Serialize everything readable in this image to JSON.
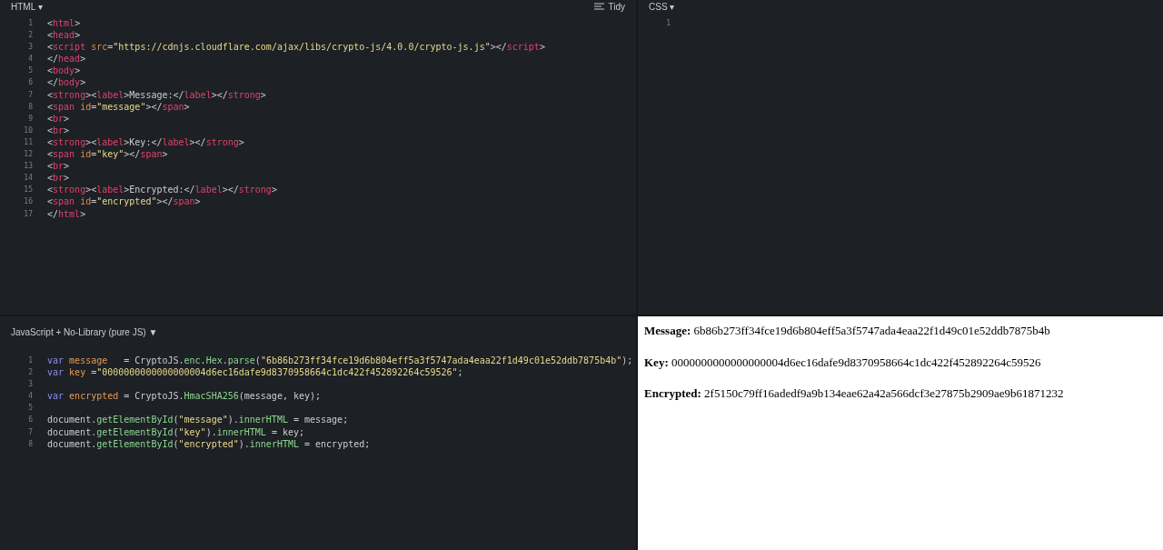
{
  "html_panel": {
    "title": "HTML ▾",
    "tidy_label": "Tidy",
    "lines": [
      {
        "number": "1",
        "tokens": [
          {
            "kind": "punct",
            "text": "<"
          },
          {
            "kind": "tag",
            "text": "html"
          },
          {
            "kind": "punct",
            "text": ">"
          }
        ]
      },
      {
        "number": "2",
        "tokens": [
          {
            "kind": "punct",
            "text": "<"
          },
          {
            "kind": "tag",
            "text": "head"
          },
          {
            "kind": "punct",
            "text": ">"
          }
        ]
      },
      {
        "number": "3",
        "tokens": [
          {
            "kind": "punct",
            "text": "<"
          },
          {
            "kind": "tag",
            "text": "script"
          },
          {
            "kind": "attr",
            "text": " src"
          },
          {
            "kind": "punct",
            "text": "="
          },
          {
            "kind": "string",
            "text": "\"https://cdnjs.cloudflare.com/ajax/libs/crypto-js/4.0.0/crypto-js.js\""
          },
          {
            "kind": "punct",
            "text": "></"
          },
          {
            "kind": "tag",
            "text": "script"
          },
          {
            "kind": "punct",
            "text": ">"
          }
        ]
      },
      {
        "number": "4",
        "tokens": [
          {
            "kind": "punct",
            "text": "</"
          },
          {
            "kind": "tag",
            "text": "head"
          },
          {
            "kind": "punct",
            "text": ">"
          }
        ]
      },
      {
        "number": "5",
        "tokens": [
          {
            "kind": "punct",
            "text": "<"
          },
          {
            "kind": "tag",
            "text": "body"
          },
          {
            "kind": "punct",
            "text": ">"
          }
        ]
      },
      {
        "number": "6",
        "tokens": [
          {
            "kind": "punct",
            "text": "</"
          },
          {
            "kind": "tag",
            "text": "body"
          },
          {
            "kind": "punct",
            "text": ">"
          }
        ]
      },
      {
        "number": "7",
        "tokens": [
          {
            "kind": "punct",
            "text": "<"
          },
          {
            "kind": "tag",
            "text": "strong"
          },
          {
            "kind": "punct",
            "text": "><"
          },
          {
            "kind": "tag",
            "text": "label"
          },
          {
            "kind": "punct",
            "text": ">Message:</"
          },
          {
            "kind": "tag",
            "text": "label"
          },
          {
            "kind": "punct",
            "text": "></"
          },
          {
            "kind": "tag",
            "text": "strong"
          },
          {
            "kind": "punct",
            "text": ">"
          }
        ]
      },
      {
        "number": "8",
        "tokens": [
          {
            "kind": "punct",
            "text": "<"
          },
          {
            "kind": "tag",
            "text": "span"
          },
          {
            "kind": "attr",
            "text": " id"
          },
          {
            "kind": "punct",
            "text": "="
          },
          {
            "kind": "string",
            "text": "\"message\""
          },
          {
            "kind": "punct",
            "text": "></"
          },
          {
            "kind": "tag",
            "text": "span"
          },
          {
            "kind": "punct",
            "text": ">"
          }
        ]
      },
      {
        "number": "9",
        "tokens": [
          {
            "kind": "punct",
            "text": "<"
          },
          {
            "kind": "tag",
            "text": "br"
          },
          {
            "kind": "punct",
            "text": ">"
          }
        ]
      },
      {
        "number": "10",
        "tokens": [
          {
            "kind": "punct",
            "text": "<"
          },
          {
            "kind": "tag",
            "text": "br"
          },
          {
            "kind": "punct",
            "text": ">"
          }
        ]
      },
      {
        "number": "11",
        "tokens": [
          {
            "kind": "punct",
            "text": "<"
          },
          {
            "kind": "tag",
            "text": "strong"
          },
          {
            "kind": "punct",
            "text": "><"
          },
          {
            "kind": "tag",
            "text": "label"
          },
          {
            "kind": "punct",
            "text": ">Key:</"
          },
          {
            "kind": "tag",
            "text": "label"
          },
          {
            "kind": "punct",
            "text": "></"
          },
          {
            "kind": "tag",
            "text": "strong"
          },
          {
            "kind": "punct",
            "text": ">"
          }
        ]
      },
      {
        "number": "12",
        "tokens": [
          {
            "kind": "punct",
            "text": "<"
          },
          {
            "kind": "tag",
            "text": "span"
          },
          {
            "kind": "attr",
            "text": " id"
          },
          {
            "kind": "punct",
            "text": "="
          },
          {
            "kind": "string",
            "text": "\"key\""
          },
          {
            "kind": "punct",
            "text": "></"
          },
          {
            "kind": "tag",
            "text": "span"
          },
          {
            "kind": "punct",
            "text": ">"
          }
        ]
      },
      {
        "number": "13",
        "tokens": [
          {
            "kind": "punct",
            "text": "<"
          },
          {
            "kind": "tag",
            "text": "br"
          },
          {
            "kind": "punct",
            "text": ">"
          }
        ]
      },
      {
        "number": "14",
        "tokens": [
          {
            "kind": "punct",
            "text": "<"
          },
          {
            "kind": "tag",
            "text": "br"
          },
          {
            "kind": "punct",
            "text": ">"
          }
        ]
      },
      {
        "number": "15",
        "tokens": [
          {
            "kind": "punct",
            "text": "<"
          },
          {
            "kind": "tag",
            "text": "strong"
          },
          {
            "kind": "punct",
            "text": "><"
          },
          {
            "kind": "tag",
            "text": "label"
          },
          {
            "kind": "punct",
            "text": ">Encrypted:</"
          },
          {
            "kind": "tag",
            "text": "label"
          },
          {
            "kind": "punct",
            "text": "></"
          },
          {
            "kind": "tag",
            "text": "strong"
          },
          {
            "kind": "punct",
            "text": ">"
          }
        ]
      },
      {
        "number": "16",
        "tokens": [
          {
            "kind": "punct",
            "text": "<"
          },
          {
            "kind": "tag",
            "text": "span"
          },
          {
            "kind": "attr",
            "text": " id"
          },
          {
            "kind": "punct",
            "text": "="
          },
          {
            "kind": "string",
            "text": "\"encrypted\""
          },
          {
            "kind": "punct",
            "text": "></"
          },
          {
            "kind": "tag",
            "text": "span"
          },
          {
            "kind": "punct",
            "text": ">"
          }
        ]
      },
      {
        "number": "17",
        "tokens": [
          {
            "kind": "punct",
            "text": "</"
          },
          {
            "kind": "tag",
            "text": "html"
          },
          {
            "kind": "punct",
            "text": ">"
          }
        ]
      }
    ]
  },
  "css_panel": {
    "title": "CSS ▾",
    "lines": [
      {
        "number": "1"
      }
    ]
  },
  "js_panel": {
    "title": "JavaScript + No-Library (pure JS) ▼",
    "lines": [
      {
        "number": "1",
        "tokens": [
          {
            "kind": "keyword",
            "text": "var "
          },
          {
            "kind": "variable",
            "text": "message"
          },
          {
            "kind": "punct",
            "text": "   = CryptoJS."
          },
          {
            "kind": "function",
            "text": "enc"
          },
          {
            "kind": "punct",
            "text": "."
          },
          {
            "kind": "function",
            "text": "Hex"
          },
          {
            "kind": "punct",
            "text": "."
          },
          {
            "kind": "function",
            "text": "parse"
          },
          {
            "kind": "punct",
            "text": "("
          },
          {
            "kind": "string",
            "text": "\"6b86b273ff34fce19d6b804eff5a3f5747ada4eaa22f1d49c01e52ddb7875b4b\""
          },
          {
            "kind": "punct",
            "text": ");"
          }
        ]
      },
      {
        "number": "2",
        "tokens": [
          {
            "kind": "keyword",
            "text": "var "
          },
          {
            "kind": "variable",
            "text": "key"
          },
          {
            "kind": "punct",
            "text": " ="
          },
          {
            "kind": "string",
            "text": "\"0000000000000000004d6ec16dafe9d8370958664c1dc422f452892264c59526\""
          },
          {
            "kind": "punct",
            "text": ";"
          }
        ]
      },
      {
        "number": "3"
      },
      {
        "number": "4",
        "tokens": [
          {
            "kind": "keyword",
            "text": "var "
          },
          {
            "kind": "variable",
            "text": "encrypted"
          },
          {
            "kind": "punct",
            "text": " = CryptoJS."
          },
          {
            "kind": "function",
            "text": "HmacSHA256"
          },
          {
            "kind": "punct",
            "text": "(message, key);"
          }
        ]
      },
      {
        "number": "5"
      },
      {
        "number": "6",
        "tokens": [
          {
            "kind": "punct",
            "text": "document."
          },
          {
            "kind": "function",
            "text": "getElementById"
          },
          {
            "kind": "punct",
            "text": "("
          },
          {
            "kind": "string",
            "text": "\"message\""
          },
          {
            "kind": "punct",
            "text": ")."
          },
          {
            "kind": "function",
            "text": "innerHTML"
          },
          {
            "kind": "punct",
            "text": " = message;"
          }
        ]
      },
      {
        "number": "7",
        "tokens": [
          {
            "kind": "punct",
            "text": "document."
          },
          {
            "kind": "function",
            "text": "getElementById"
          },
          {
            "kind": "punct",
            "text": "("
          },
          {
            "kind": "string",
            "text": "\"key\""
          },
          {
            "kind": "punct",
            "text": ")."
          },
          {
            "kind": "function",
            "text": "innerHTML"
          },
          {
            "kind": "punct",
            "text": " = key;"
          }
        ]
      },
      {
        "number": "8",
        "tokens": [
          {
            "kind": "punct",
            "text": "document."
          },
          {
            "kind": "function",
            "text": "getElementById"
          },
          {
            "kind": "punct",
            "text": "("
          },
          {
            "kind": "string",
            "text": "\"encrypted\""
          },
          {
            "kind": "punct",
            "text": ")."
          },
          {
            "kind": "function",
            "text": "innerHTML"
          },
          {
            "kind": "punct",
            "text": " = encrypted;"
          }
        ]
      }
    ]
  },
  "output": {
    "lines": [
      "**Message:** 6b86b273ff34fce19d6b804eff5a3f5747ada4eaa22f1d49c01e52ddb7875b4b",
      "**Key:** 0000000000000000004d6ec16dafe9d8370958664c1dc422f452892264c59526",
      "**Encrypted:** 2f5150c79ff16adedf9a9b134eae62a42a566dcf3e27875b2909ae9b61871232"
    ]
  }
}
